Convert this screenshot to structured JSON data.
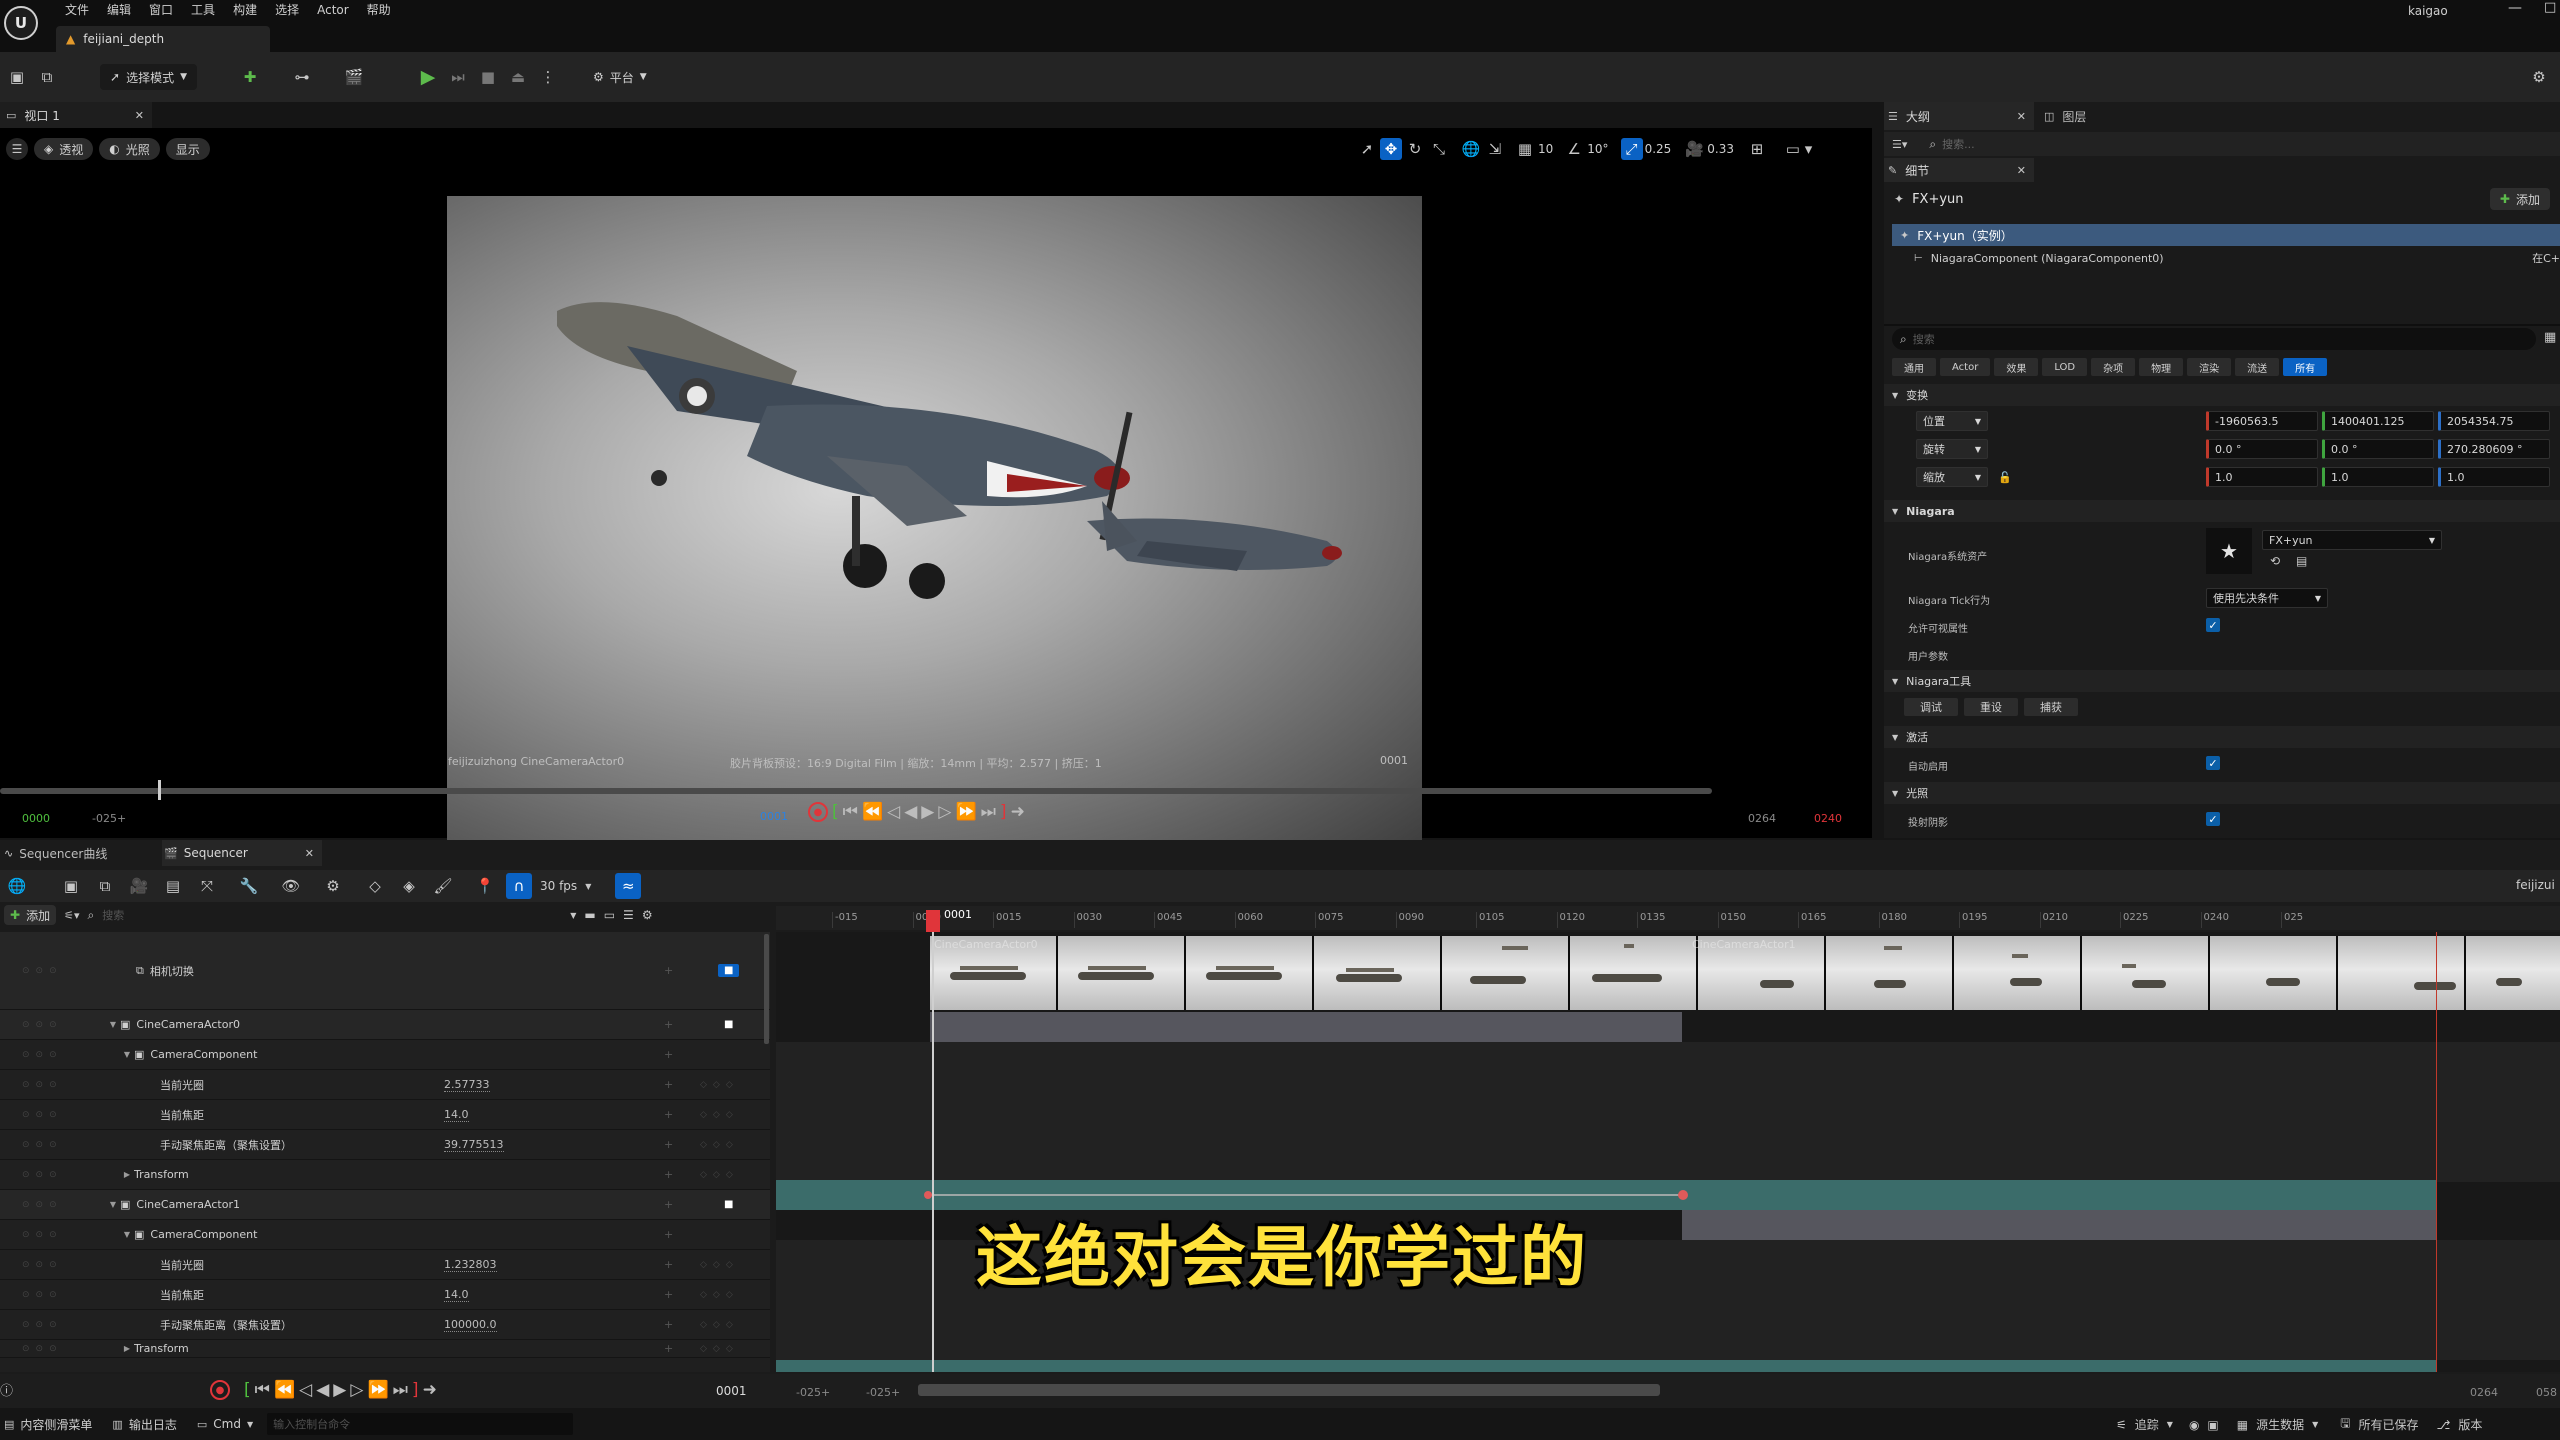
{
  "menubar": {
    "items": [
      "文件",
      "编辑",
      "窗口",
      "工具",
      "构建",
      "选择",
      "Actor",
      "帮助"
    ],
    "user": "kaigao"
  },
  "doc_tab": {
    "label": "feijiani_depth"
  },
  "toolbar": {
    "select_mode": "选择模式",
    "platform": "平台"
  },
  "viewport": {
    "tab_label": "视口 1",
    "btn_perspective": "透视",
    "btn_lit": "光照",
    "btn_show": "显示",
    "grid_value": "10",
    "angle_value": "10°",
    "scale_value": "0.25",
    "camera_speed": "0.33",
    "overlay_camera": "feijizuizhong CineCameraActor0",
    "overlay_info": "胶片背板预设：16:9 Digital Film | 缩放：14mm | 平均：2.577 | 挤压：1",
    "overlay_frame": "0001",
    "time_start": "0000",
    "time_neg": "-025+",
    "time_current": "0001",
    "time_end_a": "0264",
    "time_end_b": "0240"
  },
  "outliner": {
    "tab_outline": "大纲",
    "tab_layers": "图层",
    "search_placeholder": "搜索..."
  },
  "details": {
    "tab_label": "细节",
    "actor_name": "FX+yun",
    "add_label": "添加",
    "instance_label": "FX+yun（实例）",
    "component_label": "NiagaraComponent (NiagaraComponent0)",
    "component_edit": "在C+",
    "search_placeholder": "搜索",
    "filters": [
      "通用",
      "Actor",
      "效果",
      "LOD",
      "杂项",
      "物理",
      "渲染",
      "流送",
      "所有"
    ],
    "section_transform": "变换",
    "location_label": "位置",
    "rotation_label": "旋转",
    "scale_label": "缩放",
    "location": [
      "-1960563.5",
      "1400401.125",
      "2054354.75"
    ],
    "rotation": [
      "0.0 °",
      "0.0 °",
      "270.280609 °"
    ],
    "scale": [
      "1.0",
      "1.0",
      "1.0"
    ],
    "section_niagara": "Niagara",
    "niagara_asset_label": "Niagara系统资产",
    "niagara_asset_value": "FX+yun",
    "tick_label": "Niagara Tick行为",
    "tick_value": "使用先决条件",
    "allow_label": "允许可视属性",
    "user_params_label": "用户参数",
    "section_tools": "Niagara工具",
    "tool_debug": "调试",
    "tool_reset": "重设",
    "tool_capture": "捕获",
    "section_activation": "激活",
    "auto_activate_label": "自动启用",
    "section_lighting": "光照",
    "cast_shadow_label": "投射阴影"
  },
  "sequencer": {
    "tab_curves": "Sequencer曲线",
    "tab_sequencer": "Sequencer",
    "fps": "30 fps",
    "add_label": "添加",
    "search_placeholder": "搜索",
    "right_label": "feijizui",
    "playhead_frame": "0001",
    "ruler": [
      "-015",
      "0000",
      "0015",
      "0030",
      "0045",
      "0060",
      "0075",
      "0090",
      "0105",
      "0120",
      "0135",
      "0150",
      "0165",
      "0180",
      "0195",
      "0210",
      "0225",
      "0240",
      "025"
    ],
    "tracks": [
      {
        "name": "相机切换",
        "value": "",
        "indent": 0
      },
      {
        "name": "CineCameraActor0",
        "value": "",
        "indent": 1
      },
      {
        "name": "CameraComponent",
        "value": "",
        "indent": 2
      },
      {
        "name": "当前光圈",
        "value": "2.57733",
        "indent": 3
      },
      {
        "name": "当前焦距",
        "value": "14.0",
        "indent": 3
      },
      {
        "name": "手动聚焦距离（聚焦设置）",
        "value": "39.775513",
        "indent": 3
      },
      {
        "name": "Transform",
        "value": "",
        "indent": 2
      },
      {
        "name": "CineCameraActor1",
        "value": "",
        "indent": 1
      },
      {
        "name": "CameraComponent",
        "value": "",
        "indent": 2
      },
      {
        "name": "当前光圈",
        "value": "1.232803",
        "indent": 3
      },
      {
        "name": "当前焦距",
        "value": "14.0",
        "indent": 3
      },
      {
        "name": "手动聚焦距离（聚焦设置）",
        "value": "100000.0",
        "indent": 3
      },
      {
        "name": "Transform",
        "value": "",
        "indent": 2
      }
    ],
    "cam_label_0": "CineCameraActor0",
    "cam_label_1": "CineCameraActor1",
    "bottom_frame": "0001",
    "bottom_neg1": "-025+",
    "bottom_neg2": "-025+",
    "bottom_end": "0264",
    "bottom_end2": "058"
  },
  "subtitle": "这绝对会是你学过的",
  "statusbar": {
    "content_drawer": "内容侧滑菜单",
    "output_log": "输出日志",
    "cmd": "Cmd",
    "cmd_placeholder": "输入控制台命令",
    "trace": "追踪",
    "source_data": "源生数据",
    "all_saved": "所有已保存",
    "version_control": "版本"
  },
  "colors": {
    "accent": "#0a62c4",
    "record": "#e0353a",
    "playhead": "#e0353a",
    "track_teal": "#3b6c6a",
    "section_gray": "#56565e"
  }
}
